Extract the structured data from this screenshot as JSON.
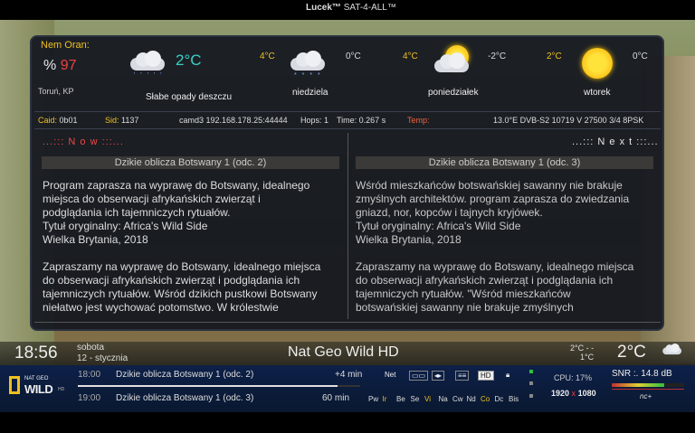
{
  "top_mark": {
    "user": "Lucek™",
    "site": "SAT-4-ALL™"
  },
  "weather": {
    "city": "Nem Oran:",
    "humidity_symbol": "%",
    "humidity": "97",
    "location": "Toruń, KP",
    "current_temp": "2°C",
    "current_desc": "Słabe opady deszczu",
    "forecast": [
      {
        "high": "4°C",
        "low": "0°C",
        "day": "niedziela",
        "icon": "snow-cloud-icon"
      },
      {
        "high": "4°C",
        "low": "-2°C",
        "day": "poniedziałek",
        "icon": "partly-sunny-icon"
      },
      {
        "high": "2°C",
        "low": "0°C",
        "day": "wtorek",
        "icon": "sun-icon"
      }
    ]
  },
  "info": {
    "caid_label": "Caid:",
    "caid": "0b01",
    "sid_label": "Sid:",
    "sid": "1137",
    "ecm": "camd3 192.168.178.25:44444",
    "hops": "Hops: 1",
    "time": "Time: 0.267 s",
    "temp_label": "Temp:",
    "tuner": "13.0°E  DVB-S2  10719  V 27500 3/4 8PSK"
  },
  "now": {
    "heading": "...::: N o w :::...",
    "title": "Dzikie oblicza Botswany 1 (odc. 2)",
    "text": "Program zaprasza na wyprawę do Botswany, idealnego\nmiejsca do obserwacji afrykańskich zwierząt i\npodglądania ich tajemniczych rytuałów.\nTytuł oryginalny: Africa's Wild Side\nWielka Brytania, 2018\n\nZapraszamy na wyprawę do Botswany, idealnego miejsca\ndo obserwacji afrykańskich zwierząt i podglądania ich\ntajemniczych rytuałów. Wśród dzikich pustkowi Botswany\nniełatwo jest wychować potomstwo. W królestwie"
  },
  "next": {
    "heading": "...::: N e x t :::...",
    "title": "Dzikie oblicza Botswany 1 (odc. 3)",
    "text": "Wśród mieszkańców botswańskiej sawanny nie brakuje\nzmyślnych architektów. program zaprasza do zwiedzania\ngniazd, nor, kopców i tajnych kryjówek.\nTytuł oryginalny: Africa's Wild Side\nWielka Brytania, 2018\n\nZapraszamy na wyprawę do Botswany, idealnego miejsca\ndo obserwacji afrykańskich zwierząt i podglądania ich\ntajemniczych rytuałów. \"Wśród mieszkańców\nbotswańskiej sawanny nie brakuje zmyślnych"
  },
  "channel": {
    "clock": "18:56",
    "day": "sobota",
    "date": "12 - stycznia",
    "name": "Nat Geo Wild HD",
    "temp_range_hi": "2°C - -",
    "temp_range_lo": "1°C",
    "temp": "2°C"
  },
  "epg": [
    {
      "time": "18:00",
      "title": "Dzikie oblicza Botswany 1 (odc. 2)",
      "duration": "+4 min"
    },
    {
      "time": "19:00",
      "title": "Dzikie oblicza Botswany 1 (odc. 3)",
      "duration": "60 min"
    }
  ],
  "progress": 0.92,
  "logo": {
    "ng": "NAT GEO",
    "wild": "WILD",
    "hd": "HD"
  },
  "badges": {
    "net": "Net",
    "hd": "HD"
  },
  "flags": [
    "Pw",
    "Ir",
    "Be",
    "Se",
    "Vi",
    "Na",
    "Cw",
    "Nd",
    "Co",
    "Dc",
    "Bis"
  ],
  "cpu": "CPU:  17%",
  "resolution_w": "1920",
  "resolution_x": "x",
  "resolution_h": "1080",
  "snr": "SNR :.  14.8 dB",
  "snr_level": 0.72,
  "nc": "nc+",
  "colors": {
    "accent": "#f0c020",
    "red": "#f04040",
    "cyan": "#3ad0c8",
    "bar_bg": "#0d2048"
  }
}
